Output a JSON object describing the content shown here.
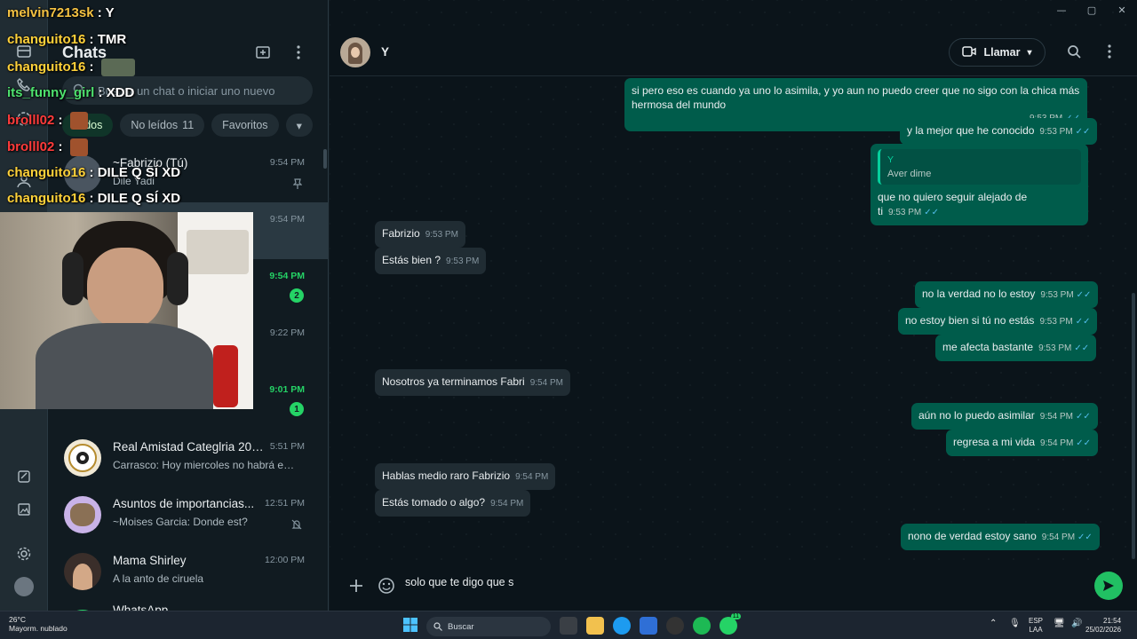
{
  "window_controls": [
    "—",
    "▢",
    "✕"
  ],
  "sidebar": {
    "title": "Chats",
    "search_placeholder": "Buscar un chat o iniciar uno nuevo",
    "filters": [
      {
        "label": "Todos",
        "count": "",
        "active": true
      },
      {
        "label": "No leídos",
        "count": "11",
        "active": false
      },
      {
        "label": "Favoritos",
        "count": "",
        "active": false
      }
    ],
    "chats": [
      {
        "name": "~Fabrizio (Tú)",
        "preview": "Dile Yadi",
        "time": "9:54 PM",
        "pinned": true
      },
      {
        "name": "",
        "preview": "",
        "time": "9:54 PM",
        "selected": true
      },
      {
        "name": "",
        "preview": "",
        "time": "9:54 PM",
        "unread": "2",
        "green": true
      },
      {
        "name": "",
        "preview": "",
        "time": "9:22 PM"
      },
      {
        "name": "",
        "preview": "",
        "time": "9:01 PM",
        "unread": "1",
        "green": true
      },
      {
        "name": "Real Amistad Categlria 200...",
        "preview": "Carrasco: Hoy miercoles no habrá entr...",
        "time": "5:51 PM"
      },
      {
        "name": "Asuntos de importancias...",
        "preview": "~Moises Garcia: Donde est?",
        "time": "12:51 PM",
        "muted": true
      },
      {
        "name": "Mama Shirley",
        "preview": "A la anto de ciruela",
        "time": "12:00 PM"
      },
      {
        "name": "WhatsApp",
        "preview": "",
        "time": ""
      }
    ]
  },
  "chat": {
    "contact_name": "Y",
    "call_label": "Llamar",
    "messages": [
      {
        "dir": "out",
        "text": "si pero eso es cuando ya uno lo asimila, y yo aun no puedo creer que no sigo con la chica más hermosa del mundo",
        "time": "9:53 PM"
      },
      {
        "dir": "out",
        "text": "y la mejor que he conocido",
        "time": "9:53 PM"
      },
      {
        "dir": "out",
        "quote_name": "Y",
        "quote_text": "Aver dime",
        "text": "que no quiero seguir alejado de ti",
        "time": "9:53 PM"
      },
      {
        "dir": "in",
        "text": "Fabrizio",
        "time": "9:53 PM"
      },
      {
        "dir": "in",
        "text": "Estás bien ?",
        "time": "9:53 PM"
      },
      {
        "dir": "out",
        "text": "no la verdad no lo estoy",
        "time": "9:53 PM"
      },
      {
        "dir": "out",
        "text": "no estoy bien si tú no estás",
        "time": "9:53 PM"
      },
      {
        "dir": "out",
        "text": "me afecta bastante",
        "time": "9:53 PM"
      },
      {
        "dir": "in",
        "text": "Nosotros ya terminamos Fabri",
        "time": "9:54 PM"
      },
      {
        "dir": "out",
        "text": "aún no lo puedo asimilar",
        "time": "9:54 PM"
      },
      {
        "dir": "out",
        "text": "regresa a mi vida",
        "time": "9:54 PM"
      },
      {
        "dir": "in",
        "text": "Hablas medio raro Fabrizio",
        "time": "9:54 PM"
      },
      {
        "dir": "in",
        "text": "Estás tomado o algo?",
        "time": "9:54 PM"
      },
      {
        "dir": "out",
        "text": "nono de verdad estoy sano",
        "time": "9:54 PM"
      }
    ],
    "composer_text": "solo que te digo que s"
  },
  "stream_chat": [
    {
      "user": "melvin7213sk",
      "msg": "Y"
    },
    {
      "user": "changuito16",
      "msg": "TMR"
    },
    {
      "user": "changuito16",
      "msg": ""
    },
    {
      "user": "its_funny_girl",
      "msg": "XDD"
    },
    {
      "user": "brolll02",
      "msg": ""
    },
    {
      "user": "brolll02",
      "msg": ""
    },
    {
      "user": "changuito16",
      "msg": "DILE Q SÍ XD"
    },
    {
      "user": "changuito16",
      "msg": "DILE Q SÍ XD"
    }
  ],
  "taskbar": {
    "temperature": "26°C",
    "weather_desc": "Mayorm. nublado",
    "search_label": "Buscar",
    "lang": "ESP",
    "region": "LAA",
    "time": "21:54",
    "date": "25/02/2026",
    "whatsapp_badge": "11"
  },
  "colors": {
    "outgoing_bubble": "#005c4b",
    "incoming_bubble": "#202c33",
    "accent_green": "#25d366",
    "background": "#0b141a"
  }
}
